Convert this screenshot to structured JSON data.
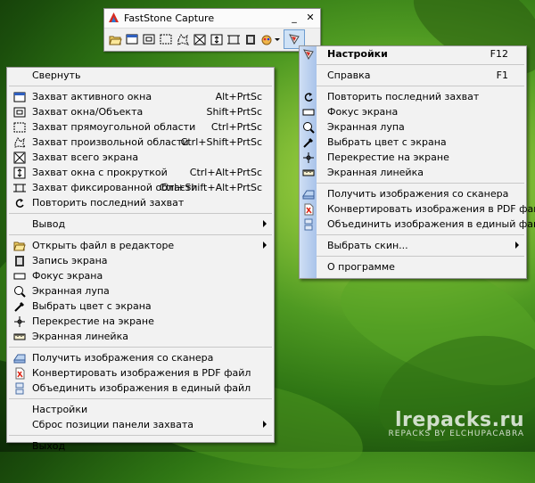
{
  "toolbar": {
    "title": "FastStone Capture",
    "minimize": "_",
    "close": "✕",
    "tools": [
      {
        "name": "open-folder-icon"
      },
      {
        "name": "capture-window-icon"
      },
      {
        "name": "capture-object-icon"
      },
      {
        "name": "capture-rect-icon"
      },
      {
        "name": "capture-freehand-icon"
      },
      {
        "name": "capture-fullscreen-icon"
      },
      {
        "name": "capture-scroll-icon"
      },
      {
        "name": "capture-fixed-icon"
      },
      {
        "name": "record-screen-icon"
      },
      {
        "name": "output-icon"
      },
      {
        "name": "settings-menu-icon"
      }
    ]
  },
  "left_menu": {
    "items": [
      {
        "label": "Свернуть",
        "key": ""
      },
      {
        "sep": true
      },
      {
        "label": "Захват активного окна",
        "key": "Alt+PrtSc",
        "icon": "window-icon"
      },
      {
        "label": "Захват окна/Объекта",
        "key": "Shift+PrtSc",
        "icon": "object-icon"
      },
      {
        "label": "Захват прямоугольной области",
        "key": "Ctrl+PrtSc",
        "icon": "rect-icon"
      },
      {
        "label": "Захват произвольной области",
        "key": "Ctrl+Shift+PrtSc",
        "icon": "freehand-icon"
      },
      {
        "label": "Захват всего экрана",
        "key": "",
        "icon": "fullscreen-icon"
      },
      {
        "label": "Захват окна с прокруткой",
        "key": "Ctrl+Alt+PrtSc",
        "icon": "scroll-icon"
      },
      {
        "label": "Захват фиксированной области",
        "key": "Ctrl+Shift+Alt+PrtSc",
        "icon": "fixed-icon"
      },
      {
        "label": "Повторить последний захват",
        "key": "",
        "icon": "repeat-icon"
      },
      {
        "sep": true
      },
      {
        "label": "Вывод",
        "key": "",
        "submenu": true
      },
      {
        "sep": true
      },
      {
        "label": "Открыть файл в редакторе",
        "key": "",
        "icon": "open-folder-icon",
        "submenu": true
      },
      {
        "label": "Запись экрана",
        "key": "",
        "icon": "film-icon"
      },
      {
        "label": "Фокус экрана",
        "key": "",
        "icon": "focus-icon"
      },
      {
        "label": "Экранная лупа",
        "key": "",
        "icon": "magnifier-icon"
      },
      {
        "label": "Выбрать цвет с экрана",
        "key": "",
        "icon": "eyedropper-icon"
      },
      {
        "label": "Перекрестие на экране",
        "key": "",
        "icon": "crosshair-icon"
      },
      {
        "label": "Экранная линейка",
        "key": "",
        "icon": "ruler-icon"
      },
      {
        "sep": true
      },
      {
        "label": "Получить изображения со сканера",
        "key": "",
        "icon": "scanner-icon"
      },
      {
        "label": "Конвертировать изображения в PDF файл",
        "key": "",
        "icon": "pdf-icon"
      },
      {
        "label": "Объединить изображения в единый файл",
        "key": "",
        "icon": "combine-icon"
      },
      {
        "sep": true
      },
      {
        "label": "Настройки",
        "key": ""
      },
      {
        "label": "Сброс позиции панели захвата",
        "key": "",
        "submenu": true
      },
      {
        "sep": true
      },
      {
        "label": "Выход",
        "key": ""
      }
    ]
  },
  "right_menu": {
    "items": [
      {
        "label": "Настройки",
        "key": "F12",
        "icon": "settings-icon",
        "bold": true
      },
      {
        "sep": true
      },
      {
        "label": "Справка",
        "key": "F1"
      },
      {
        "sep": true
      },
      {
        "label": "Повторить последний захват",
        "key": "",
        "icon": "repeat-icon"
      },
      {
        "label": "Фокус экрана",
        "key": "",
        "icon": "focus-icon"
      },
      {
        "label": "Экранная лупа",
        "key": "",
        "icon": "magnifier-icon"
      },
      {
        "label": "Выбрать цвет с экрана",
        "key": "",
        "icon": "eyedropper-icon"
      },
      {
        "label": "Перекрестие на экране",
        "key": "",
        "icon": "crosshair-icon"
      },
      {
        "label": "Экранная линейка",
        "key": "",
        "icon": "ruler-icon"
      },
      {
        "sep": true
      },
      {
        "label": "Получить изображения со сканера",
        "key": "",
        "icon": "scanner-icon"
      },
      {
        "label": "Конвертировать изображения в PDF файл",
        "key": "",
        "icon": "pdf-icon"
      },
      {
        "label": "Объединить изображения в единый файл",
        "key": "",
        "icon": "combine-icon"
      },
      {
        "sep": true
      },
      {
        "label": "Выбрать скин...",
        "key": "",
        "submenu": true
      },
      {
        "sep": true
      },
      {
        "label": "О программе",
        "key": ""
      }
    ]
  },
  "watermark": {
    "main": "lrepacks.ru",
    "sub": "REPACKS BY ELCHUPACABRA"
  }
}
